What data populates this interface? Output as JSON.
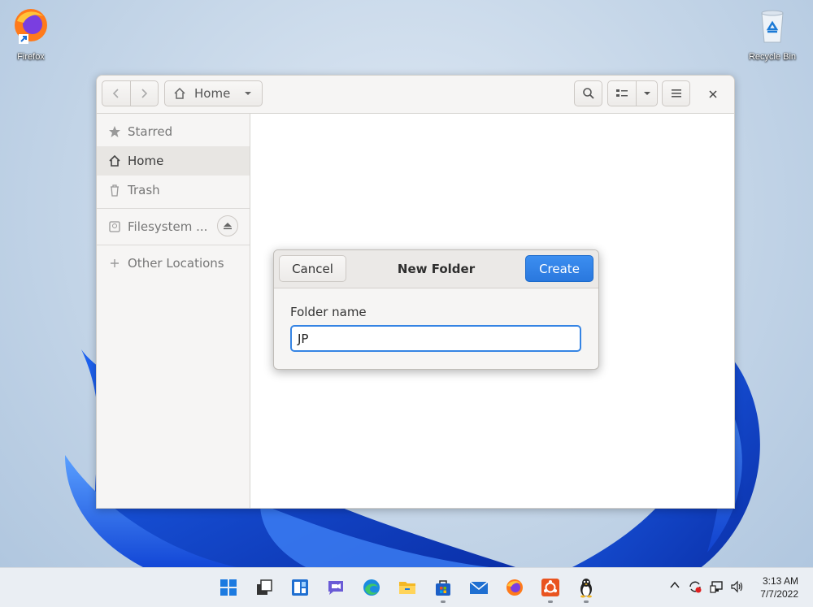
{
  "desktop": {
    "icons": [
      {
        "label": "Firefox"
      },
      {
        "label": "Recycle Bin"
      }
    ]
  },
  "file_manager": {
    "path_button": {
      "label": "Home"
    },
    "sidebar": [
      {
        "label": "Starred",
        "icon": "star-icon",
        "active": false
      },
      {
        "label": "Home",
        "icon": "home-icon",
        "active": true
      },
      {
        "label": "Trash",
        "icon": "trash-icon",
        "active": false
      },
      {
        "label": "Filesystem ...",
        "icon": "drive-icon",
        "active": false
      },
      {
        "label": "Other Locations",
        "icon": "plus-icon",
        "active": false
      }
    ]
  },
  "dialog": {
    "title": "New Folder",
    "cancel_label": "Cancel",
    "create_label": "Create",
    "field_label": "Folder name",
    "field_value": "JP"
  },
  "taskbar": {
    "apps": [
      "start-icon",
      "task-view-icon",
      "widgets-icon",
      "chat-icon",
      "edge-icon",
      "file-explorer-icon",
      "store-icon",
      "mail-icon",
      "firefox-icon",
      "ubuntu-icon",
      "linux-penguin-icon"
    ],
    "clock": {
      "time": "3:13 AM",
      "date": "7/7/2022"
    }
  },
  "colors": {
    "accent": "#3584e4",
    "taskbar": "#eaeef3"
  }
}
